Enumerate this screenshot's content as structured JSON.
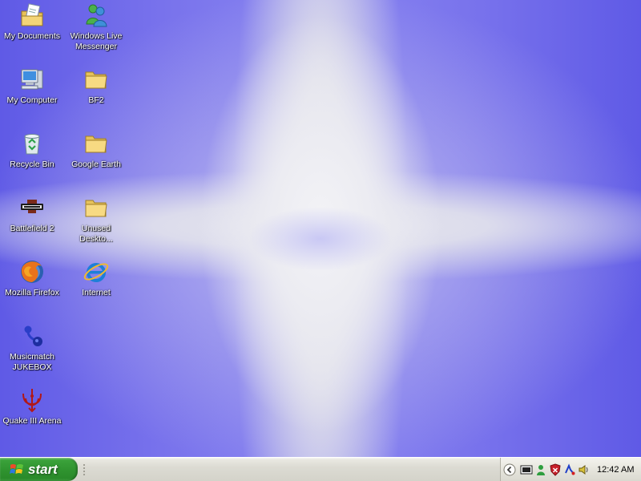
{
  "desktop": {
    "icons": [
      {
        "label": "My Documents",
        "icon": "my-documents-icon"
      },
      {
        "label": "Windows Live Messenger",
        "icon": "messenger-icon"
      },
      {
        "label": "My Computer",
        "icon": "my-computer-icon"
      },
      {
        "label": "BF2",
        "icon": "folder-icon"
      },
      {
        "label": "Recycle Bin",
        "icon": "recycle-bin-icon"
      },
      {
        "label": "Google Earth",
        "icon": "folder-icon"
      },
      {
        "label": "Battlefield 2",
        "icon": "battlefield-icon"
      },
      {
        "label": "Unused Deskto...",
        "icon": "folder-icon"
      },
      {
        "label": "Mozilla Firefox",
        "icon": "firefox-icon"
      },
      {
        "label": "Internet",
        "icon": "internet-explorer-icon"
      },
      {
        "label": "Musicmatch JUKEBOX",
        "icon": "musicmatch-icon"
      },
      {
        "label": "Quake III Arena",
        "icon": "quake-icon"
      }
    ],
    "colors": {
      "wallpaper_blue": "#6a65ea",
      "wallpaper_white": "#ececf2"
    }
  },
  "taskbar": {
    "start_label": "start",
    "tray_icons": [
      "show-hidden-icons-chevron",
      "network-icon",
      "messenger-tray-icon",
      "security-shield-icon",
      "audio-tray-icon",
      "volume-icon"
    ],
    "clock": "12:42 AM"
  }
}
